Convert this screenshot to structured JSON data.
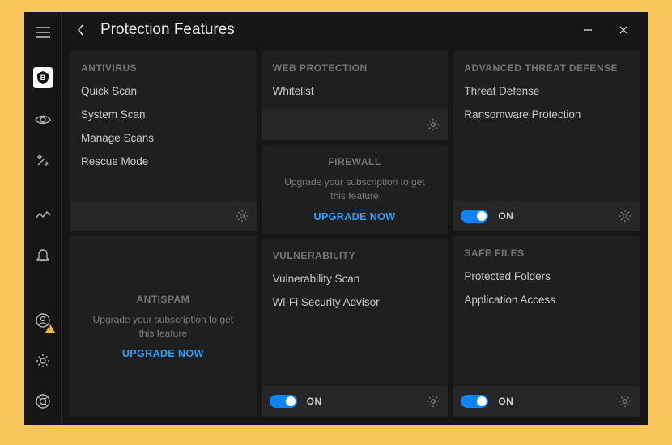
{
  "header": {
    "title": "Protection Features"
  },
  "upgrade": {
    "message": "Upgrade your subscription to get this feature",
    "cta": "UPGRADE NOW"
  },
  "toggle": {
    "on_label": "ON"
  },
  "cards": {
    "antivirus": {
      "title": "ANTIVIRUS",
      "items": [
        "Quick Scan",
        "System Scan",
        "Manage Scans",
        "Rescue Mode"
      ]
    },
    "antispam": {
      "title": "ANTISPAM"
    },
    "webprotection": {
      "title": "WEB PROTECTION",
      "items": [
        "Whitelist"
      ]
    },
    "firewall": {
      "title": "FIREWALL"
    },
    "vulnerability": {
      "title": "VULNERABILITY",
      "items": [
        "Vulnerability Scan",
        "Wi-Fi Security Advisor"
      ]
    },
    "atd": {
      "title": "ADVANCED THREAT DEFENSE",
      "items": [
        "Threat Defense",
        "Ransomware Protection"
      ]
    },
    "safefiles": {
      "title": "SAFE FILES",
      "items": [
        "Protected Folders",
        "Application Access"
      ]
    }
  }
}
